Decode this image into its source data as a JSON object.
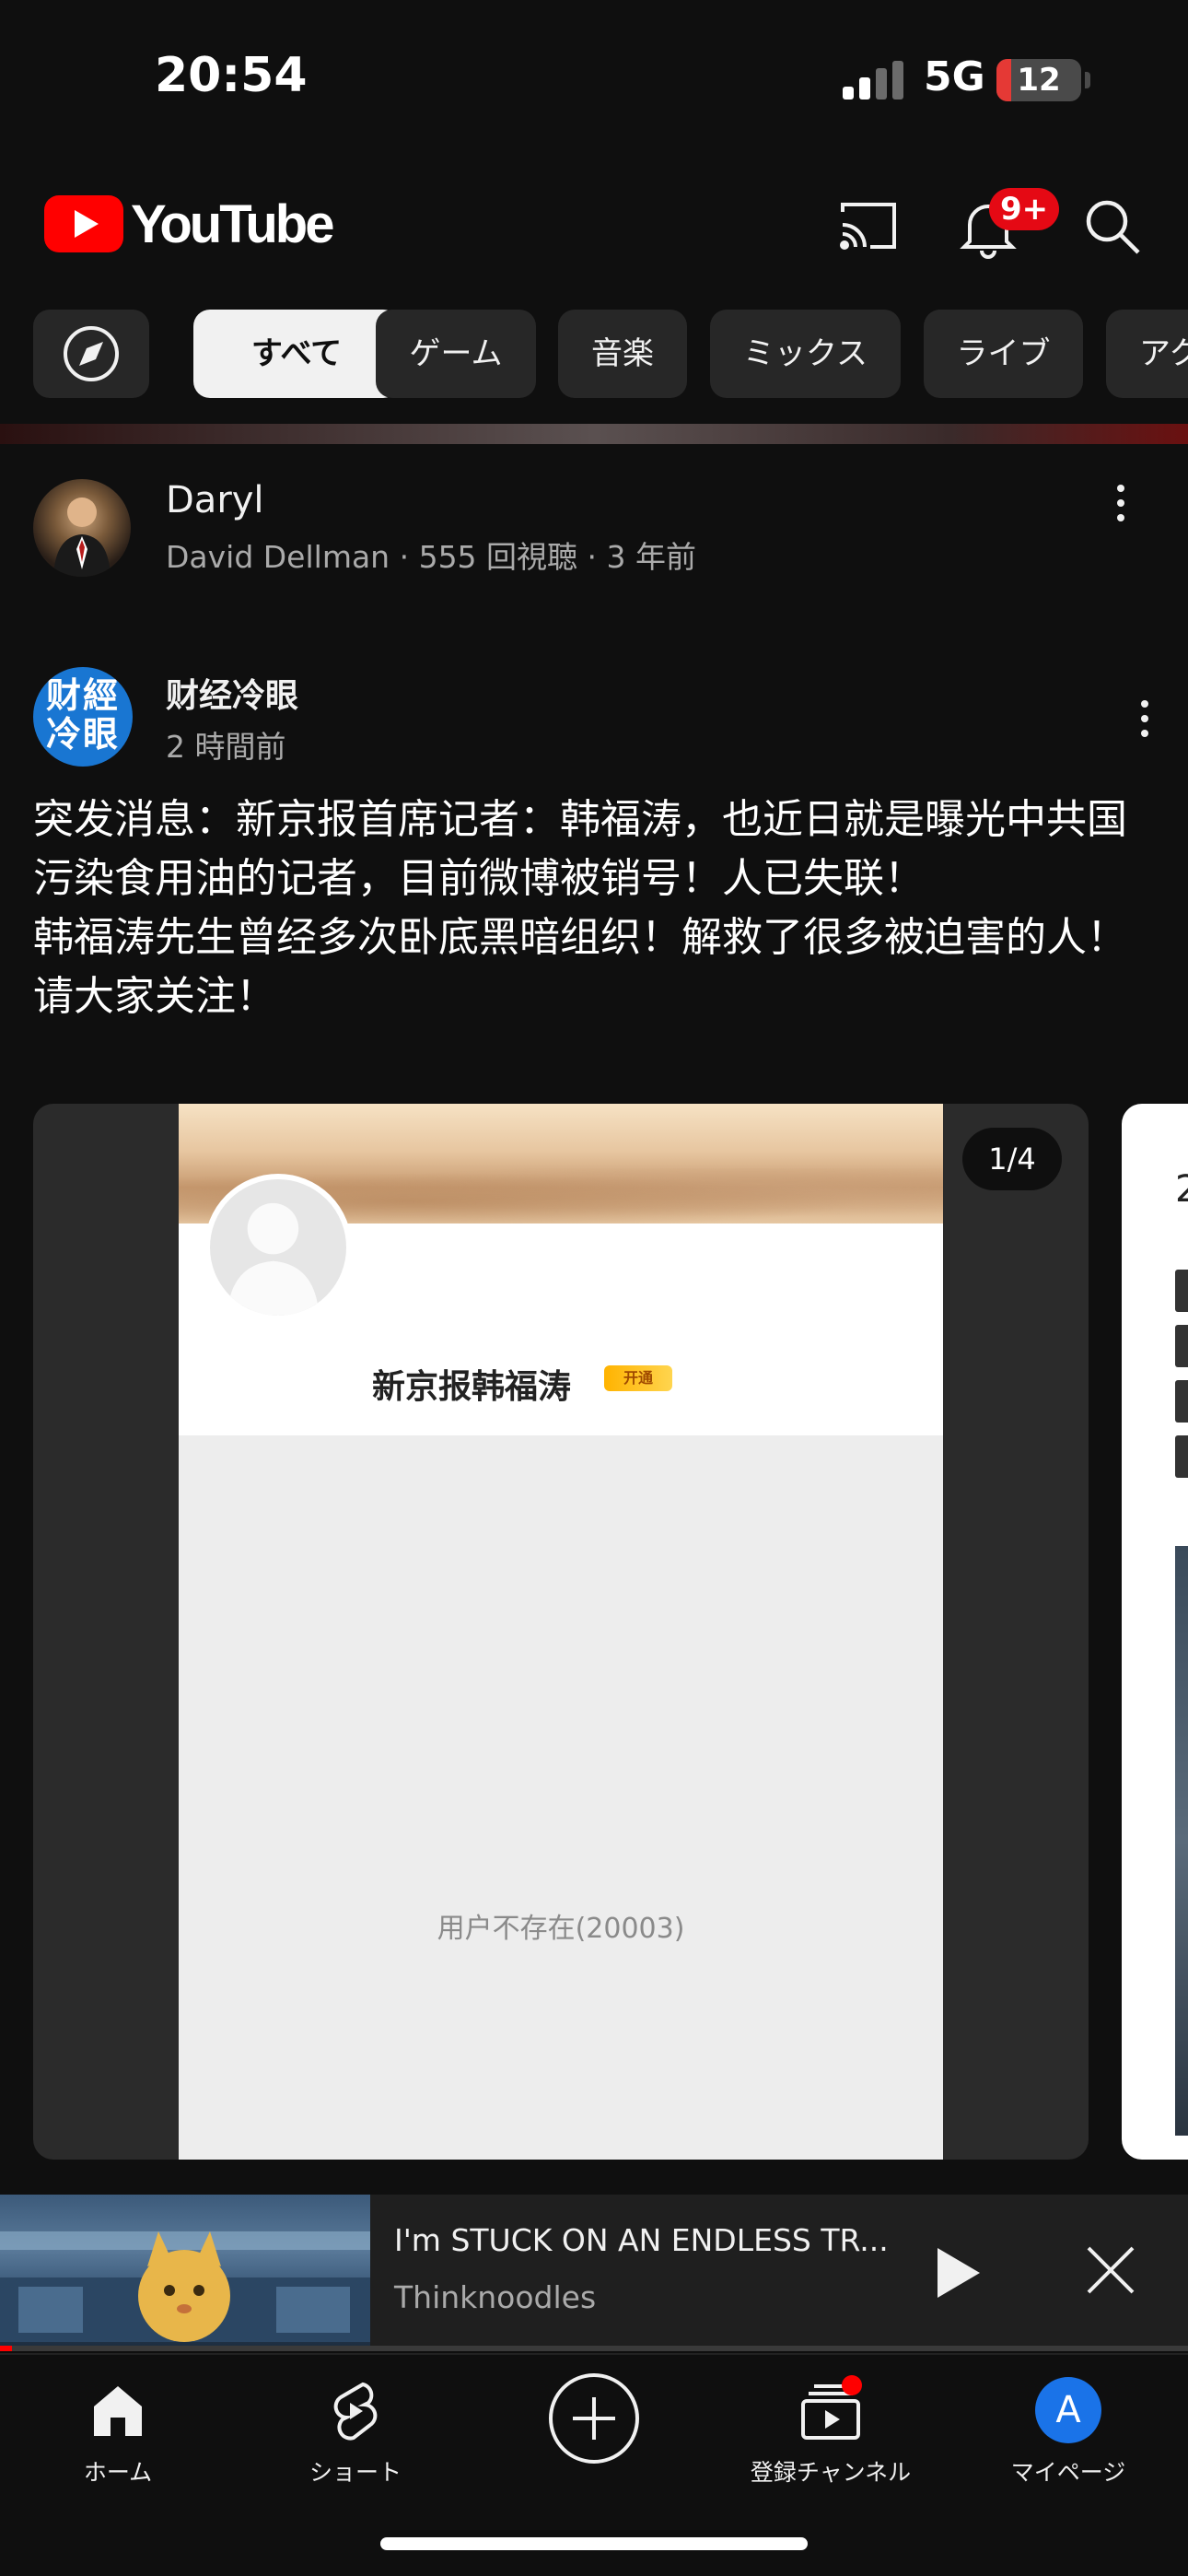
{
  "status_bar": {
    "time": "20:54",
    "network": "5G",
    "battery": "12"
  },
  "header": {
    "app_name": "YouTube",
    "notification_count": "9+"
  },
  "chips": [
    {
      "label": "すべて",
      "active": true
    },
    {
      "label": "ゲーム"
    },
    {
      "label": "音楽"
    },
    {
      "label": "ミックス"
    },
    {
      "label": "ライブ"
    },
    {
      "label": "アク"
    }
  ],
  "previous_video": {
    "title": "Daryl",
    "meta": "David Dellman · 555 回視聴 · 3 年前"
  },
  "post": {
    "avatar_text": "财經\n冷眼",
    "channel": "财经冷眼",
    "time": "2 時間前",
    "body": [
      "突发消息：新京报首席记者：韩福涛，也近日就是曝光中共国污染食用油的记者，目前微博被销号！人已失联！",
      "韩福涛先生曾经多次卧底黑暗组织！解救了很多被迫害的人！",
      "请大家关注！"
    ],
    "image": {
      "profile_name": "新京报韩福涛",
      "vip_badge": "开通",
      "message": "用户不存在(20003)",
      "page_indicator": "1/4"
    },
    "next_card": {
      "number": "2"
    }
  },
  "miniplayer": {
    "title": "I'm STUCK ON AN ENDLESS TR...",
    "channel": "Thinknoodles",
    "progress": 0.01
  },
  "bottom_nav": {
    "home": "ホーム",
    "shorts": "ショート",
    "subscriptions": "登録チャンネル",
    "you": "マイページ",
    "avatar_letter": "A"
  },
  "colors": {
    "brand_red": "#ff0000",
    "background": "#0f0f0f",
    "chip_bg": "#272727",
    "avatar_blue": "#1a73e8"
  },
  "icons": [
    "cast-icon",
    "bell-icon",
    "search-icon",
    "compass-icon",
    "kebab-menu-icon",
    "play-icon",
    "close-icon",
    "home-icon",
    "shorts-icon",
    "create-icon",
    "subscriptions-icon"
  ]
}
